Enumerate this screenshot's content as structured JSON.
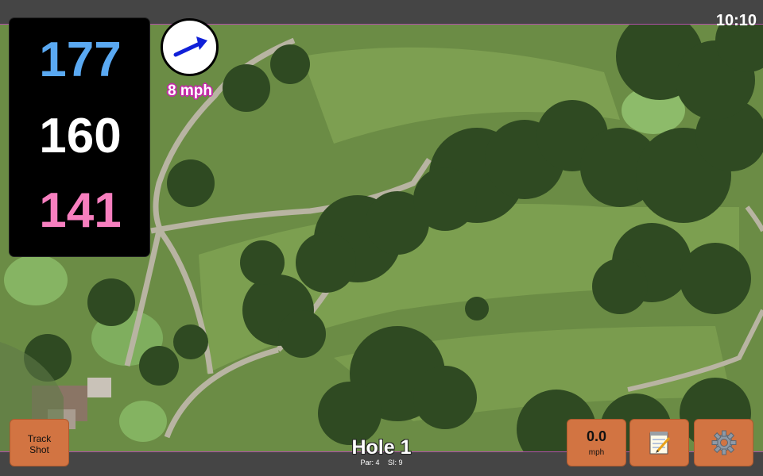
{
  "status": {
    "time": "10:10"
  },
  "yardages": {
    "back": "177",
    "center": "160",
    "front": "141"
  },
  "wind": {
    "speed_label": "8 mph",
    "icon": "arrow-icon",
    "direction": "east-northeast"
  },
  "hole": {
    "title": "Hole 1",
    "par_label": "Par: 4",
    "si_label": "SI: 9"
  },
  "buttons": {
    "track_shot_line1": "Track",
    "track_shot_line2": "Shot",
    "speed_value": "0.0",
    "speed_unit": "mph",
    "notes_icon": "notepad-icon",
    "settings_icon": "gear-icon"
  },
  "colors": {
    "back_yardage": "#5aa9f2",
    "center_yardage": "#ffffff",
    "front_yardage": "#f77fbf",
    "button": "#d27442",
    "wind_outline": "#c42aa8"
  }
}
